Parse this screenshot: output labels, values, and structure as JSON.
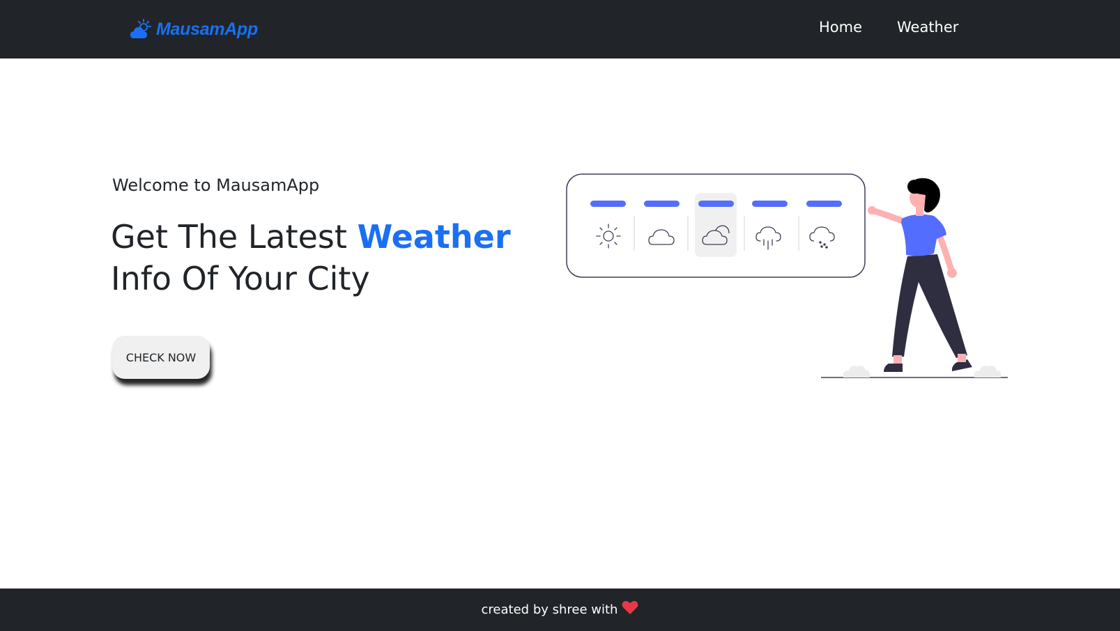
{
  "navbar": {
    "brand_label": "MausamApp",
    "brand_icon": "sun-cloud-icon",
    "links": [
      {
        "label": "Home"
      },
      {
        "label": "Weather"
      }
    ]
  },
  "hero": {
    "welcome": "Welcome to MausamApp",
    "headline_part1": "Get The Latest ",
    "headline_accent": "Weather",
    "headline_part2": "Info Of Your City",
    "cta_label": "CHECK NOW"
  },
  "illustration": {
    "weather_icons": [
      "sun-icon",
      "cloud-icon",
      "cloud-sun-icon",
      "rain-cloud-icon",
      "snow-cloud-icon"
    ],
    "selected_index": 2
  },
  "footer": {
    "text": "created by shree with",
    "icon": "heart-icon"
  },
  "colors": {
    "navbar_bg": "#212529",
    "accent": "#1a6ff5",
    "bar_blue": "#536dfe",
    "heart": "#e63946"
  }
}
